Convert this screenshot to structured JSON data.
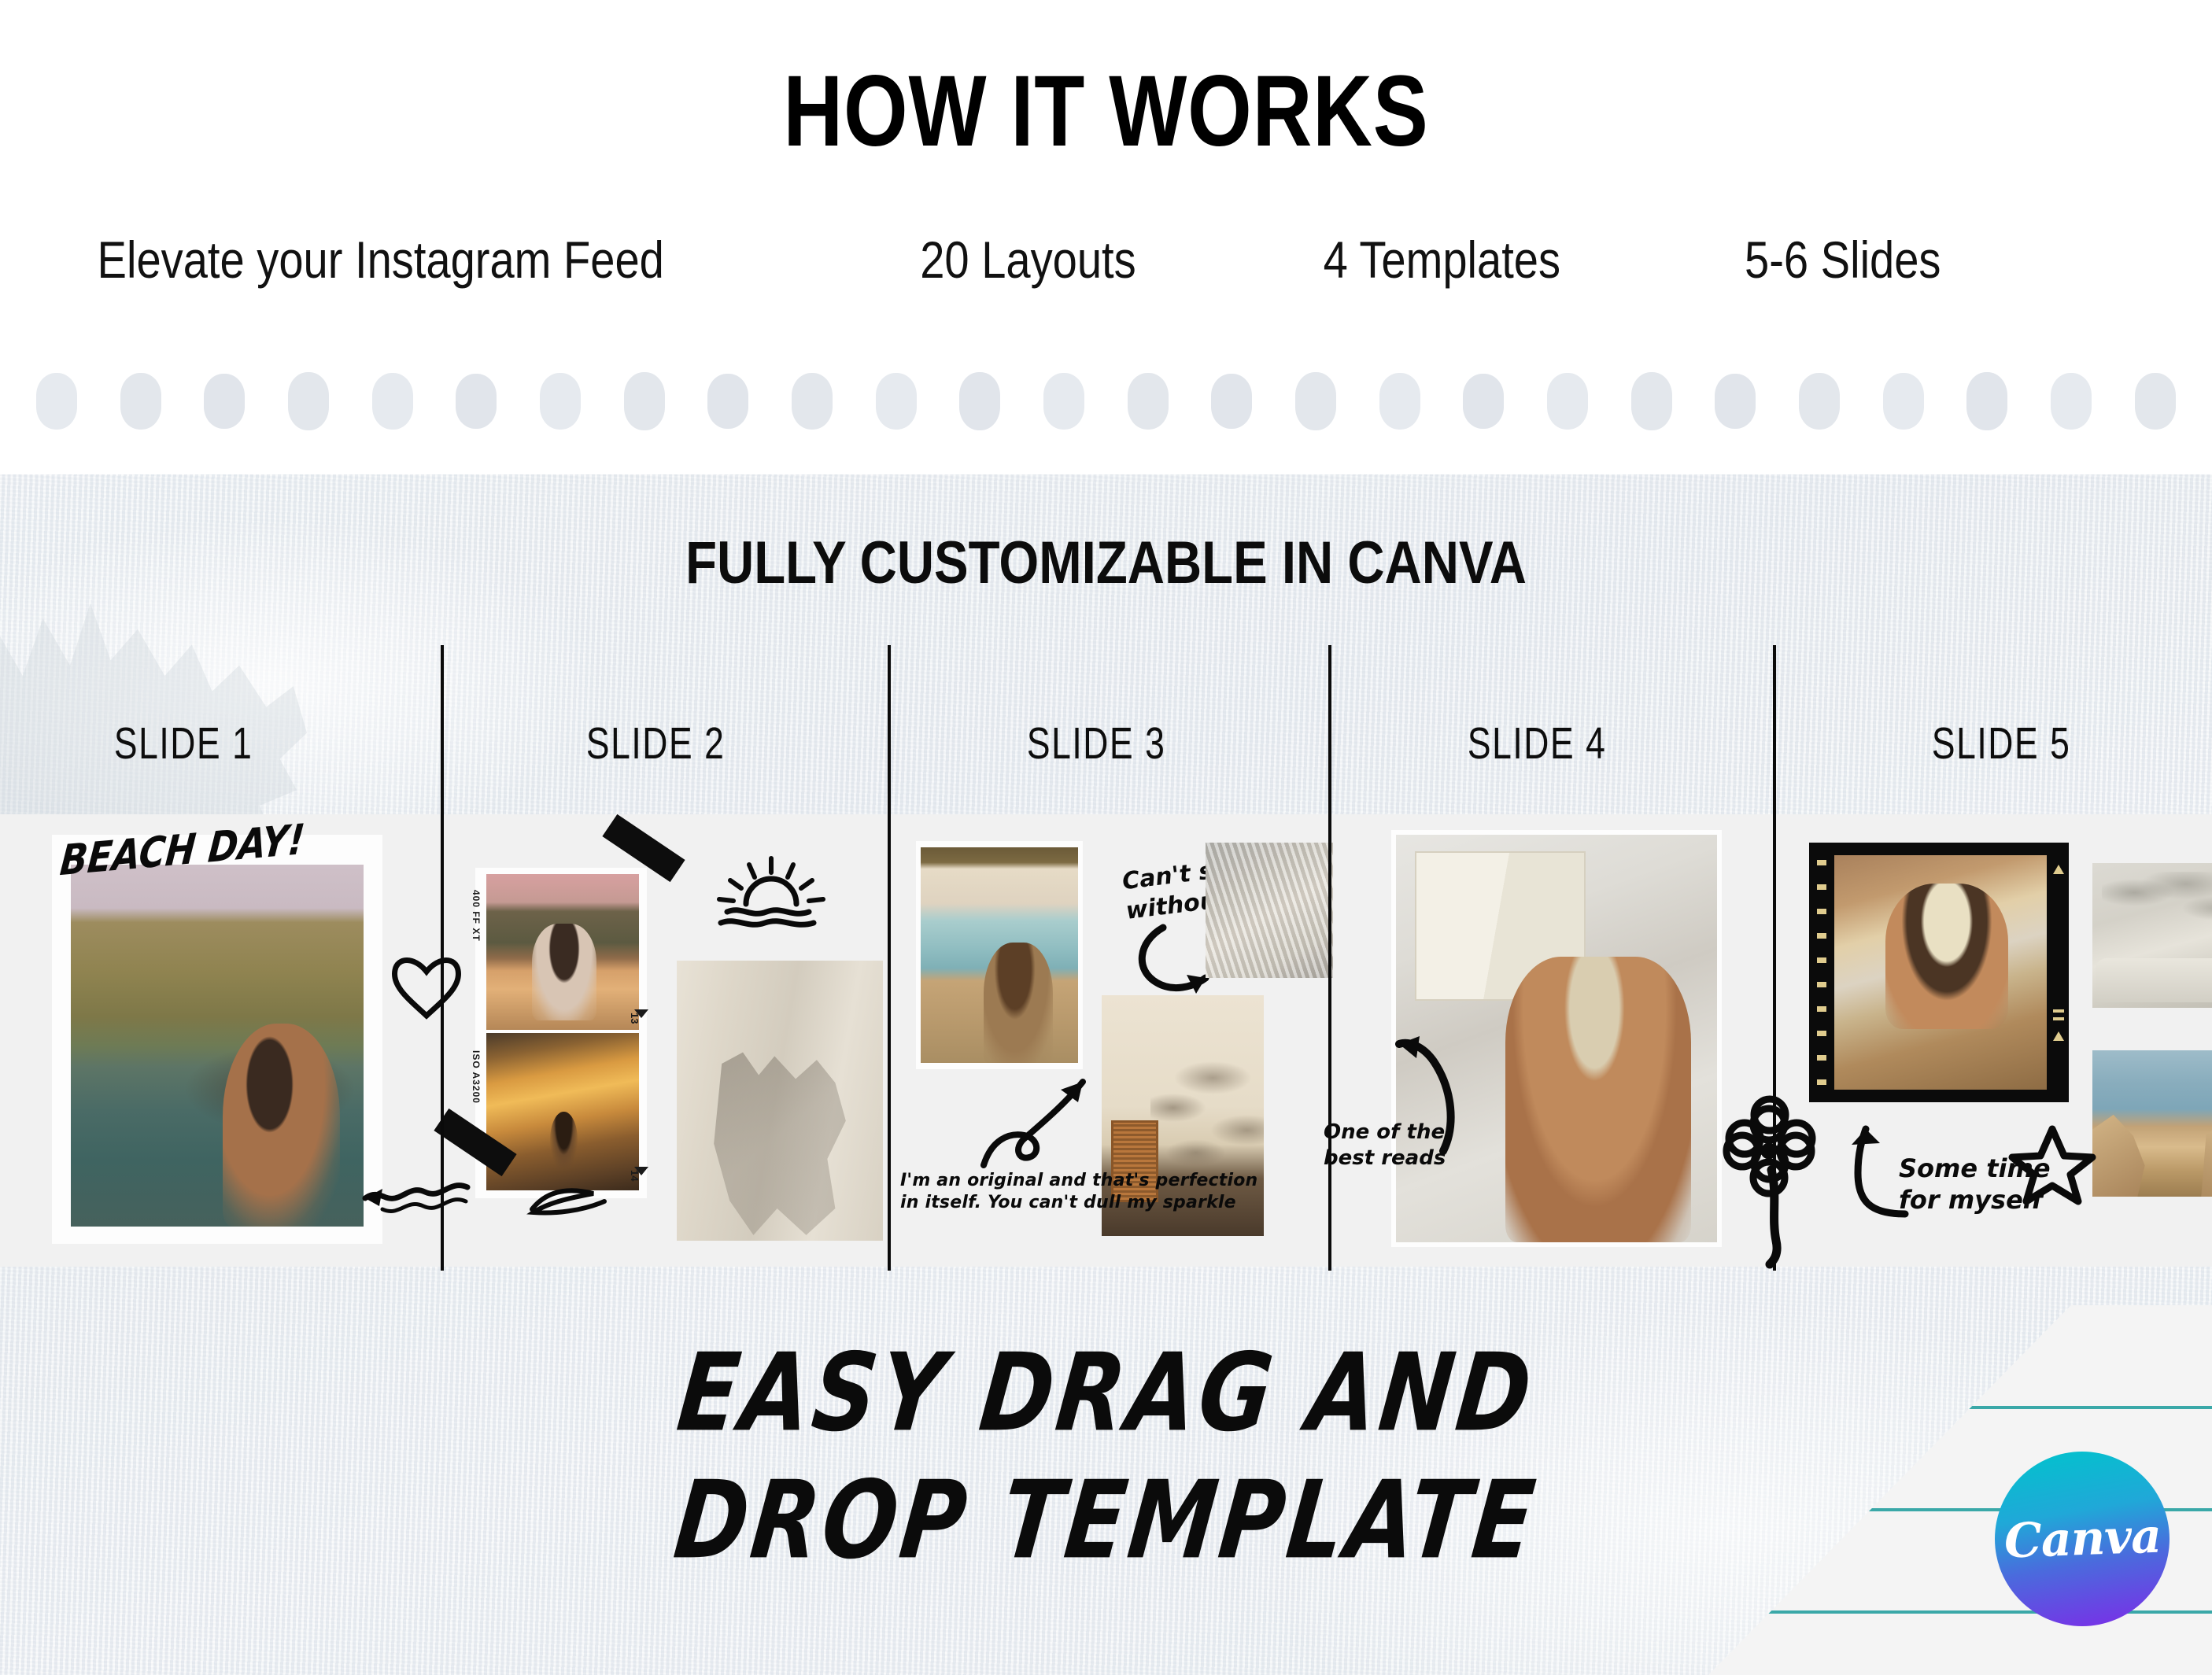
{
  "header": {
    "title": "HOW IT WORKS",
    "features": [
      "Elevate your Instagram Feed",
      "20 Layouts",
      "4 Templates",
      "5-6 Slides"
    ]
  },
  "section": {
    "title": "FULLY CUSTOMIZABLE IN CANVA"
  },
  "slides": [
    {
      "label": "SLIDE 1",
      "caption": "BEACH DAY!",
      "doodles": [
        "heart-doodle",
        "squiggle-arrow-doodle"
      ],
      "photos": [
        "woman-in-sea-with-mountains"
      ]
    },
    {
      "label": "SLIDE 2",
      "film_labels": [
        "400 FF  XT",
        "ISO  A3200"
      ],
      "film_numbers": [
        "13",
        "14"
      ],
      "doodles": [
        "sun-doodle",
        "scribble-doodle",
        "black-tape-strip",
        "black-tape-strip"
      ],
      "photos": [
        "woman-with-camera-at-sunset",
        "swimmer-in-golden-water",
        "laundry-shadow-on-linen"
      ]
    },
    {
      "label": "SLIDE 3",
      "caption_top": "Can't swim\nwithout it",
      "caption_bottom": "I'm an original and that's perfection\nin itself. You can't dull my sparkle",
      "doodles": [
        "curved-arrow-doodle",
        "looped-arrow-doodle"
      ],
      "photos": [
        "woman-looking-out-train-window",
        "woven-beach-chairs",
        "palm-shadows-on-wall"
      ]
    },
    {
      "label": "SLIDE 4",
      "caption": "One of the\nbest reads",
      "doodles": [
        "curved-arrow-doodle",
        "flower-doodle"
      ],
      "photos": [
        "woman-reading-book-in-bucket-hat"
      ]
    },
    {
      "label": "SLIDE 5",
      "caption": "Some time\nfor myself",
      "doodles": [
        "hook-arrow-doodle",
        "star-doodle",
        "flower-doodle",
        "brush-stroke"
      ],
      "photos": [
        "woman-writing-on-beach-filmframe",
        "palm-shadow-over-daybed",
        "reader-on-rocky-shore"
      ]
    }
  ],
  "footer": {
    "headline_line1": "EASY DRAG AND",
    "headline_line2": "DROP TEMPLATE"
  },
  "brand": {
    "name": "Canva",
    "gradient_start": "#00c4cc",
    "gradient_end": "#7d2ae8",
    "rule_color": "#3aa8a8"
  },
  "palette": {
    "background": "#ffffff",
    "canvas": "#e5eaee",
    "strip": "#f1f1f1",
    "ink": "#0a0a0a",
    "dot": "#e3e7ec"
  }
}
